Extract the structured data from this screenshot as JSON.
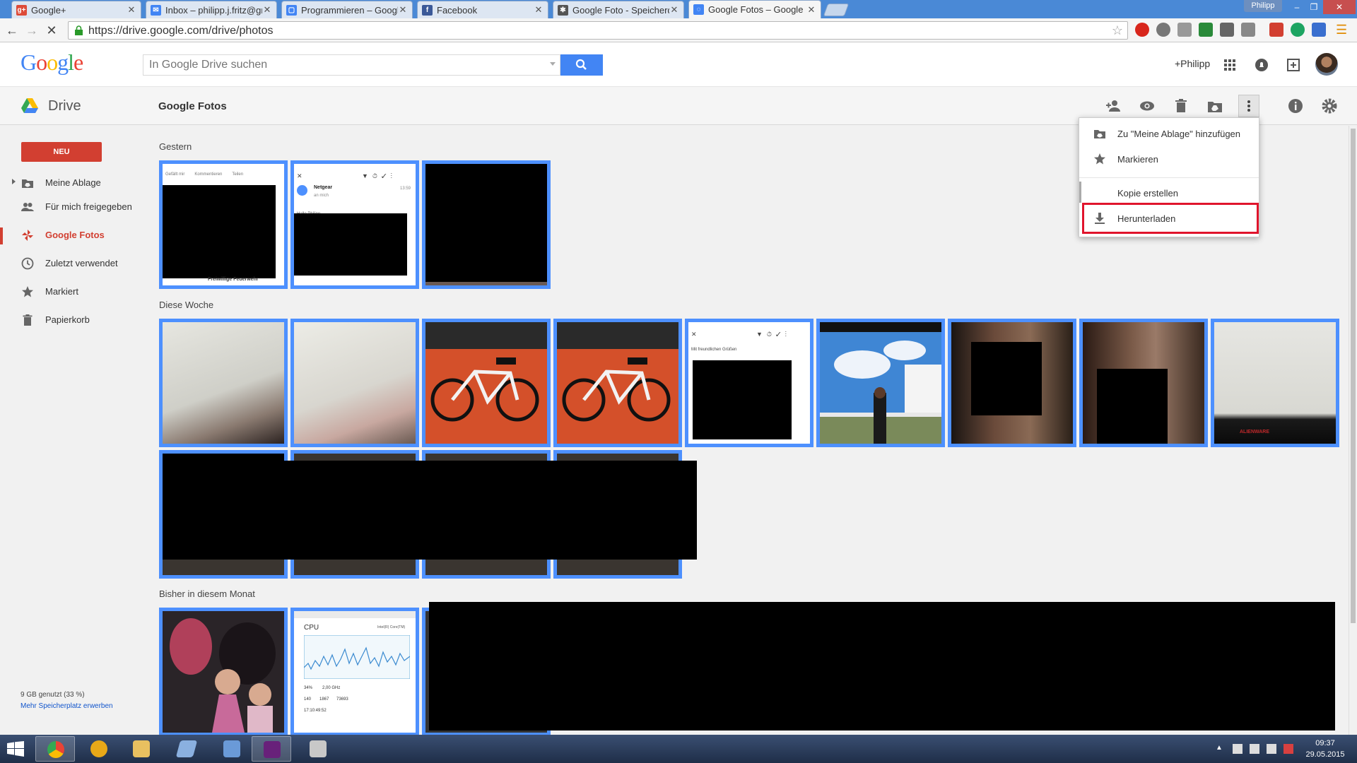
{
  "browser": {
    "tabs": [
      {
        "title": "Google+",
        "favicon_color": "#dd4b39",
        "favicon_glyph": "g+"
      },
      {
        "title": "Inbox – philipp.j.fritz@gm",
        "favicon_color": "#4285f4",
        "favicon_glyph": "✉"
      },
      {
        "title": "Programmieren – Google",
        "favicon_color": "#4285f4",
        "favicon_glyph": "▢"
      },
      {
        "title": "Facebook",
        "favicon_color": "#3b5998",
        "favicon_glyph": "f"
      },
      {
        "title": "Google Foto - Speicherq",
        "favicon_color": "#555555",
        "favicon_glyph": "✱"
      },
      {
        "title": "Google Fotos – Google D",
        "favicon_color": "#4285f4",
        "favicon_glyph": "◌"
      }
    ],
    "profile_name": "Philipp",
    "url": "https://drive.google.com/drive/photos",
    "window_buttons": {
      "minimize": "–",
      "maximize": "❐",
      "close": "✕"
    }
  },
  "header": {
    "logo_letters": [
      "G",
      "o",
      "o",
      "g",
      "l",
      "e"
    ],
    "logo_colors": [
      "#4285f4",
      "#ea4335",
      "#fbbc05",
      "#4285f4",
      "#34a853",
      "#ea4335"
    ],
    "search_placeholder": "In Google Drive suchen",
    "plus_user": "+Philipp"
  },
  "drive_bar": {
    "app_name": "Drive",
    "folder_title": "Google Fotos"
  },
  "sidebar": {
    "new_button": "NEU",
    "items": [
      {
        "label": "Meine Ablage",
        "icon": "my-drive-icon"
      },
      {
        "label": "Für mich freigegeben",
        "icon": "shared-people-icon"
      },
      {
        "label": "Google Fotos",
        "icon": "photos-pinwheel-icon",
        "active": true
      },
      {
        "label": "Zuletzt verwendet",
        "icon": "clock-icon"
      },
      {
        "label": "Markiert",
        "icon": "star-icon"
      },
      {
        "label": "Papierkorb",
        "icon": "trash-icon"
      }
    ],
    "storage_used": "9 GB genutzt (33 %)",
    "storage_link": "Mehr Speicherplatz erwerben"
  },
  "sections": [
    {
      "label": "Gestern"
    },
    {
      "label": "Diese Woche"
    },
    {
      "label": "Bisher in diesem Monat"
    }
  ],
  "thumb_text": {
    "fb_actions": [
      "Gefällt mir",
      "Kommentieren",
      "Teilen"
    ],
    "fb_caption": "Freiwillige Feuerwehr",
    "mail_sender": "Netgear",
    "mail_sub": "an mich",
    "mail_time": "13:59",
    "mail_greeting": "Hallo Philipp",
    "mail2_text": "Mit freundlichen Grüßen",
    "laptop_brand": "ALIENWARE",
    "cpu_title": "CPU",
    "cpu_model": "Intel(R) Core(TM)",
    "cpu_usage": "34%",
    "cpu_speed": "2,00 GHz",
    "cpu_procs": "140",
    "cpu_threads": "1867",
    "cpu_handles": "73693",
    "cpu_uptime": "17:10:49:52"
  },
  "context_menu": {
    "items": [
      {
        "label": "Zu \"Meine Ablage\" hinzufügen",
        "icon": "add-to-drive-icon"
      },
      {
        "label": "Markieren",
        "icon": "star-icon"
      },
      {
        "label": "Kopie erstellen",
        "icon": ""
      },
      {
        "label": "Herunterladen",
        "icon": "download-icon"
      }
    ]
  },
  "taskbar": {
    "time": "09:37",
    "date": "29.05.2015"
  },
  "colors": {
    "accent_red": "#d23f31",
    "selection_blue": "#4d90fe",
    "search_blue": "#4285f4",
    "highlight_red": "#e0142c"
  }
}
